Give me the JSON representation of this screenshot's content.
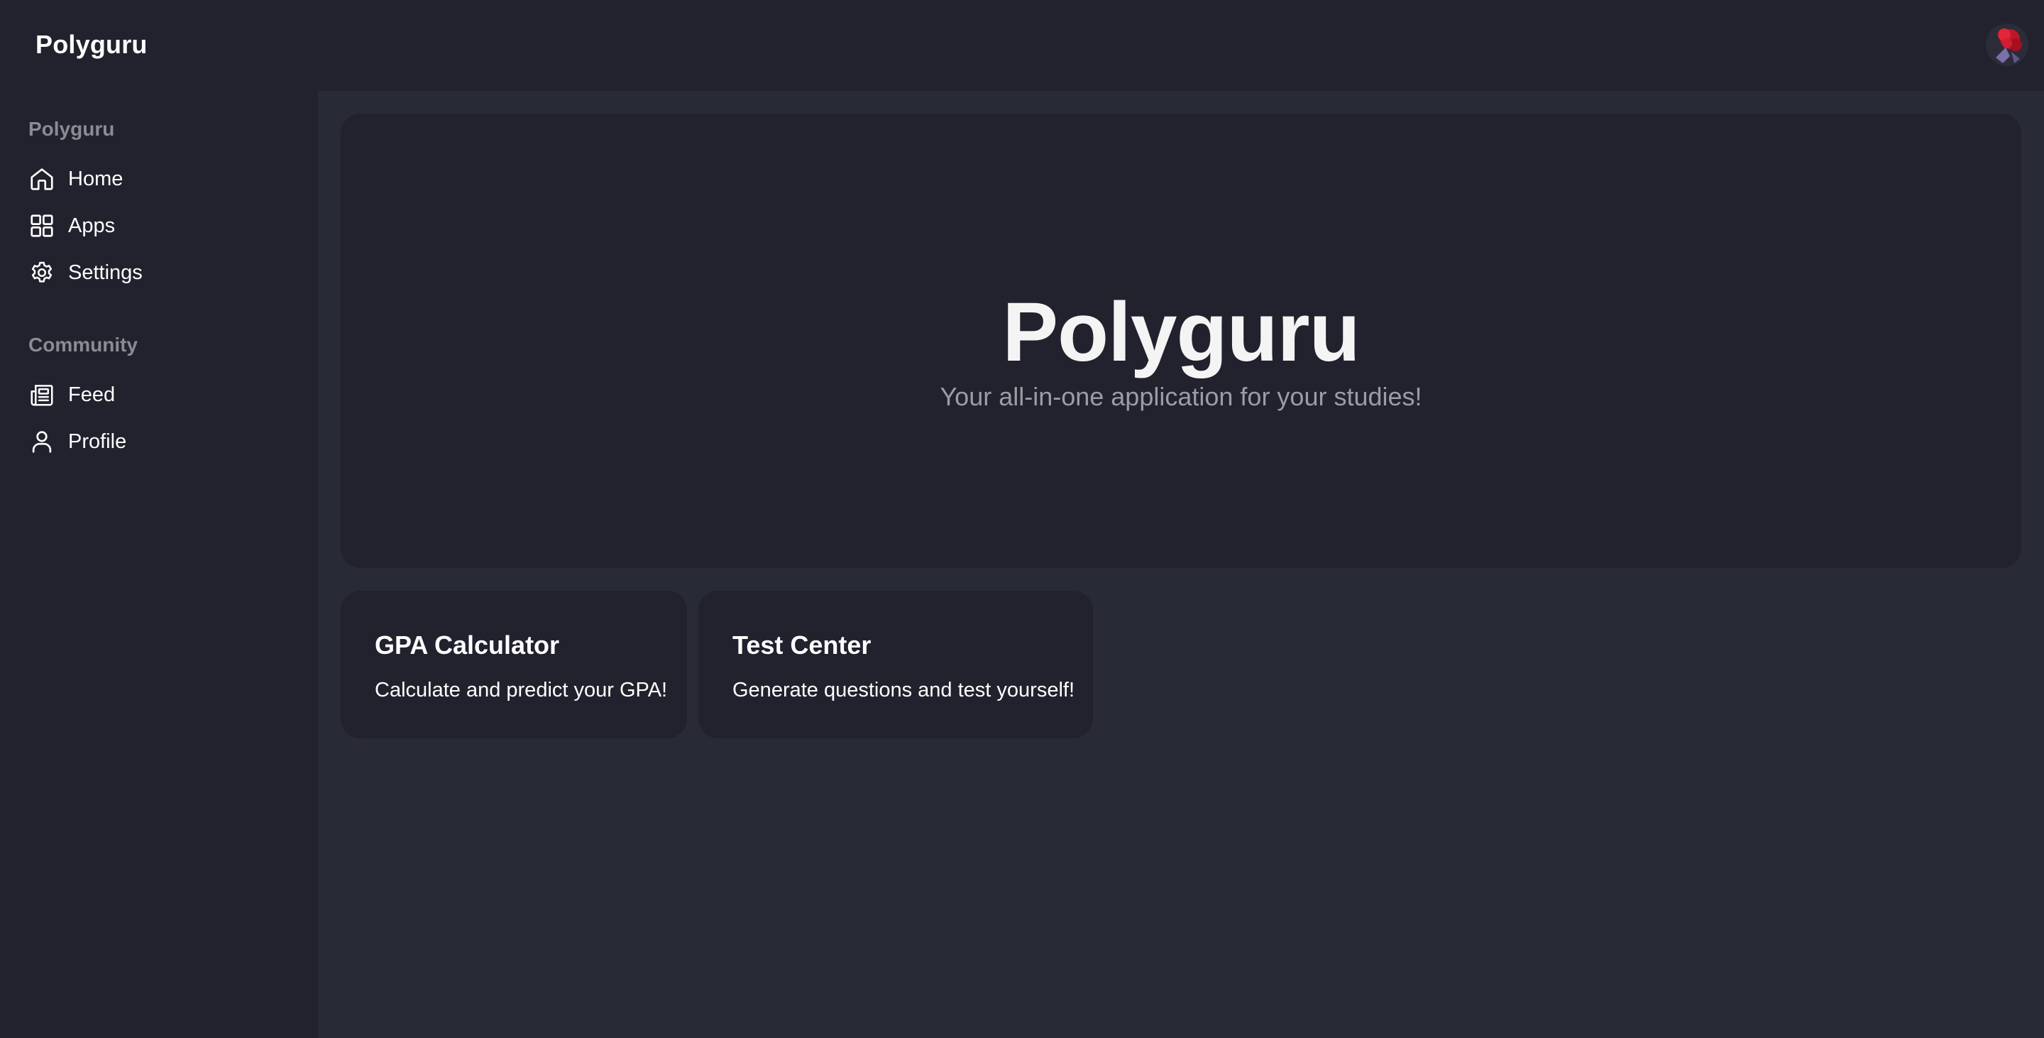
{
  "header": {
    "brand": "Polyguru",
    "avatar_icon": "user-avatar-image"
  },
  "sidebar": {
    "sections": [
      {
        "title": "Polyguru",
        "items": [
          {
            "label": "Home",
            "icon": "home-icon"
          },
          {
            "label": "Apps",
            "icon": "grid-icon"
          },
          {
            "label": "Settings",
            "icon": "gear-icon"
          }
        ]
      },
      {
        "title": "Community",
        "items": [
          {
            "label": "Feed",
            "icon": "newspaper-icon"
          },
          {
            "label": "Profile",
            "icon": "user-icon"
          }
        ]
      }
    ]
  },
  "hero": {
    "title": "Polyguru",
    "subtitle": "Your all-in-one application for your studies!"
  },
  "cards": [
    {
      "title": "GPA Calculator",
      "description": "Calculate and predict your GPA!"
    },
    {
      "title": "Test Center",
      "description": "Generate questions and test yourself!"
    }
  ],
  "colors": {
    "background": "#21222d",
    "main_background": "#282a36",
    "card_background": "#21222d",
    "muted_text": "#8a8b94",
    "subtitle_text": "#9b9ca5",
    "text": "#ffffff"
  }
}
